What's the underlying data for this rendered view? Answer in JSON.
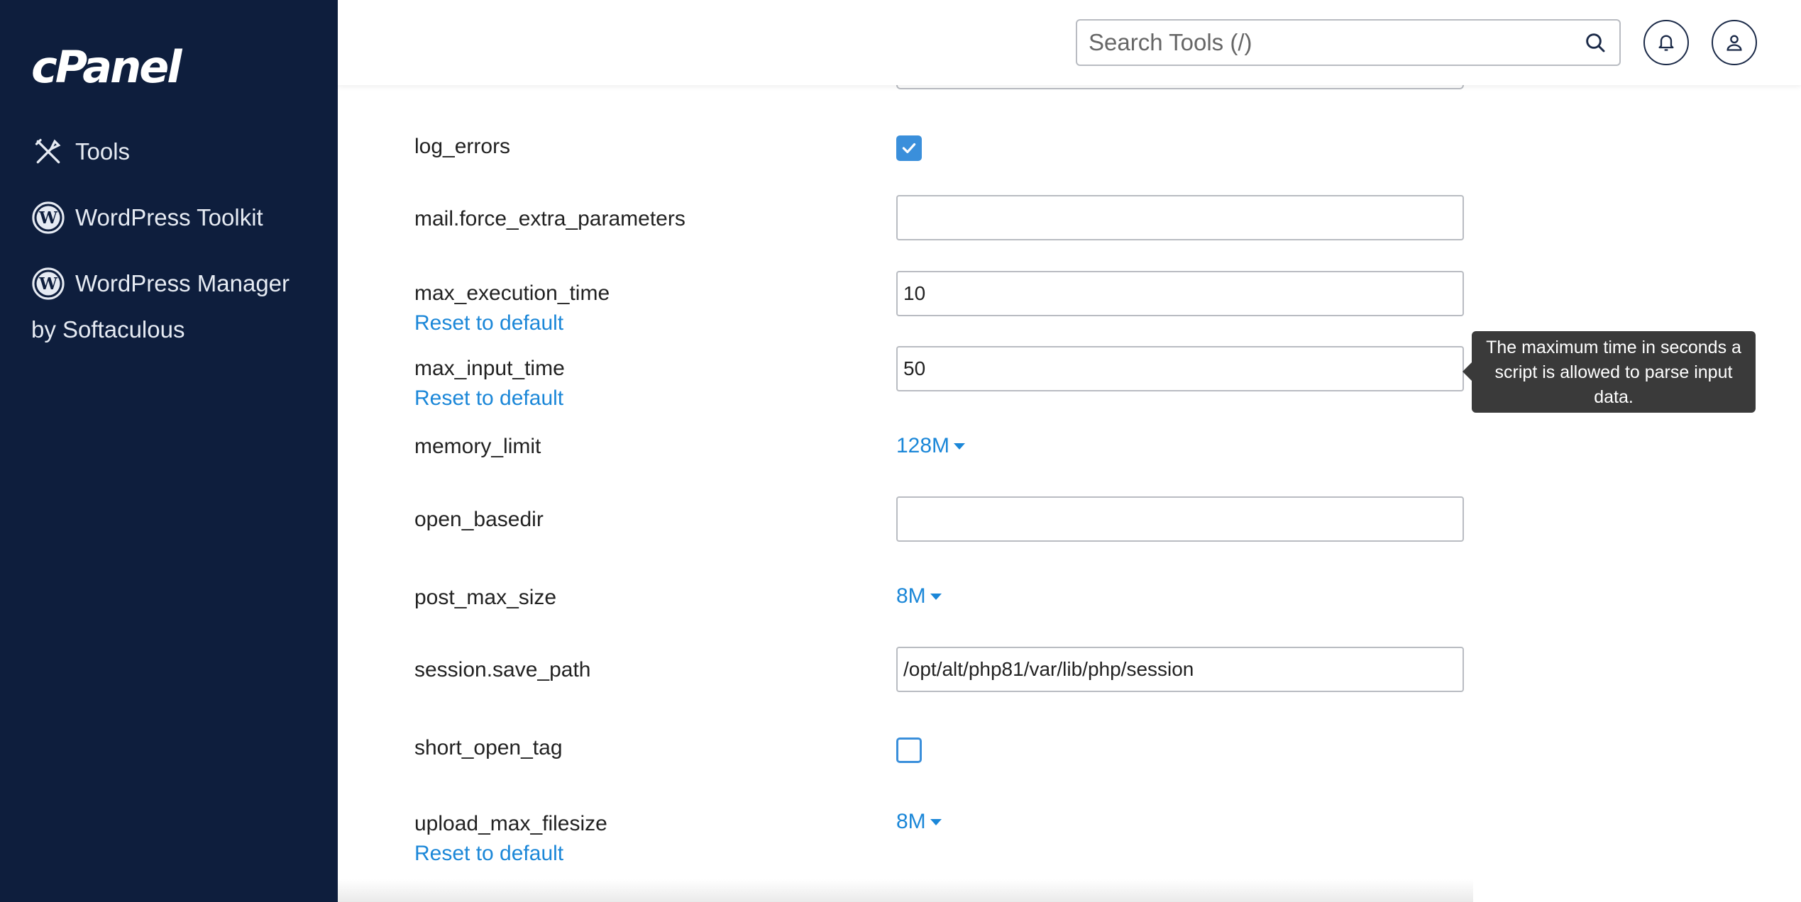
{
  "sidebar": {
    "logo": "cPanel",
    "items": [
      {
        "label": "Tools",
        "icon": "tools-icon"
      },
      {
        "label": "WordPress Toolkit",
        "icon": "wordpress-icon"
      },
      {
        "label": "WordPress Manager",
        "icon": "wordpress-icon"
      }
    ],
    "manager_sub": "by Softaculous"
  },
  "header": {
    "search_placeholder": "Search Tools (/)"
  },
  "settings": {
    "log_errors": {
      "label": "log_errors",
      "checked": true
    },
    "mail_force": {
      "label": "mail.force_extra_parameters",
      "value": ""
    },
    "max_execution_time": {
      "label": "max_execution_time",
      "value": "10",
      "reset": "Reset to default"
    },
    "max_input_time": {
      "label": "max_input_time",
      "value": "50",
      "reset": "Reset to default"
    },
    "memory_limit": {
      "label": "memory_limit",
      "value": "128M"
    },
    "open_basedir": {
      "label": "open_basedir",
      "value": ""
    },
    "post_max_size": {
      "label": "post_max_size",
      "value": "8M"
    },
    "session_save_path": {
      "label": "session.save_path",
      "value": "/opt/alt/php81/var/lib/php/session"
    },
    "short_open_tag": {
      "label": "short_open_tag",
      "checked": false
    },
    "upload_max_filesize": {
      "label": "upload_max_filesize",
      "value": "8M",
      "reset": "Reset to default"
    }
  },
  "tooltip": {
    "text": "The maximum time in seconds a script is allowed to parse input data."
  },
  "colors": {
    "sidebar_bg": "#0e1e3d",
    "link": "#1b87d8",
    "checkbox": "#3a8fdb",
    "tooltip_bg": "#3a3a3a"
  }
}
